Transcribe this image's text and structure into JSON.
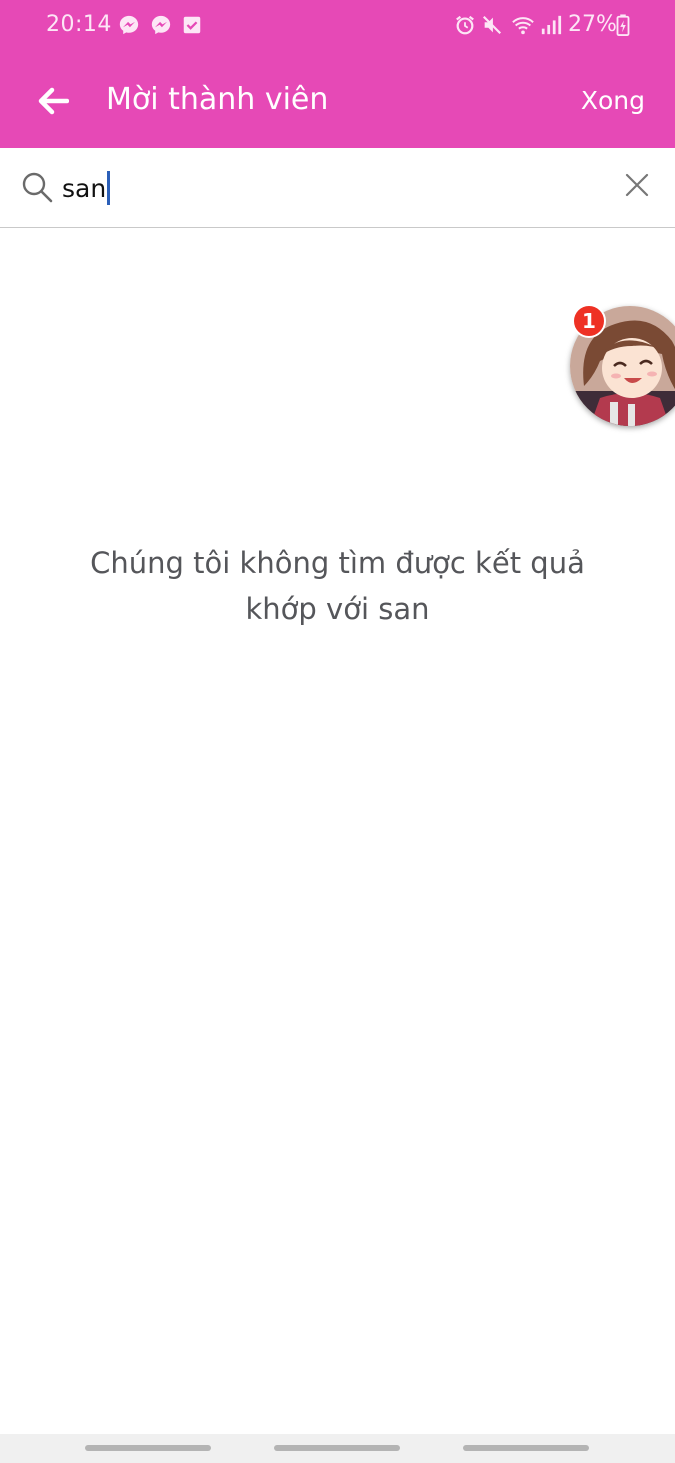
{
  "colors": {
    "header_bg": "#e649b6",
    "header_text": "#ffffff",
    "badge": "#ee3124",
    "caret": "#2b5fb8"
  },
  "status_bar": {
    "time": "20:14",
    "battery": "27%",
    "left_icons": [
      "messenger-icon",
      "messenger-icon",
      "download-check-icon"
    ],
    "right_icons": [
      "alarm-icon",
      "mute-icon",
      "wifi-icon",
      "signal-icon",
      "battery-charging-icon"
    ]
  },
  "toolbar": {
    "back_icon": "arrow-left-icon",
    "title": "Mời thành viên",
    "done_label": "Xong"
  },
  "search": {
    "icon": "search-icon",
    "value": "san",
    "clear_icon": "close-icon"
  },
  "chat_head": {
    "badge_count": "1",
    "avatar": "anime-girl-avatar"
  },
  "empty_state": {
    "line1": "Chúng tôi không tìm được kết quả",
    "line2": "khớp với san"
  },
  "nav_bar": {
    "items": [
      "nav-pill",
      "nav-pill",
      "nav-pill"
    ]
  }
}
